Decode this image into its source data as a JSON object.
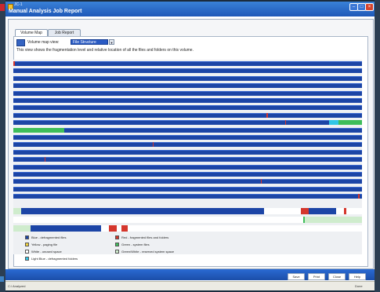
{
  "window": {
    "app_name": "JC-1",
    "title": "Manual Analysis Job Report"
  },
  "tabs": [
    {
      "label": "Volume Map"
    },
    {
      "label": "Job Report"
    }
  ],
  "volume_map": {
    "view_label": "Volume map view:",
    "view_value": "File Structure",
    "description": "This view shows the fragmentation level and relative location of all the files and folders on this volume."
  },
  "legend": [
    {
      "label": "Blue - defragmented files",
      "color": "#1c45a6"
    },
    {
      "label": "Red - fragmented files and folders",
      "color": "#d5362c"
    },
    {
      "label": "Yellow - paging file",
      "color": "#f0d23c"
    },
    {
      "label": "Green - system files",
      "color": "#3ebd5b"
    },
    {
      "label": "White - unused space",
      "color": "#ffffff"
    },
    {
      "label": "Green/White - reserved system space",
      "color": "#cfeccd"
    },
    {
      "label": "Light Blue - defragmented folders",
      "color": "#31c6e6"
    }
  ],
  "buttons": {
    "save": "Save",
    "print": "Print",
    "close": "Close",
    "help": "Help"
  },
  "status": {
    "left": "C:\\ Analyzed",
    "right": "Done"
  }
}
